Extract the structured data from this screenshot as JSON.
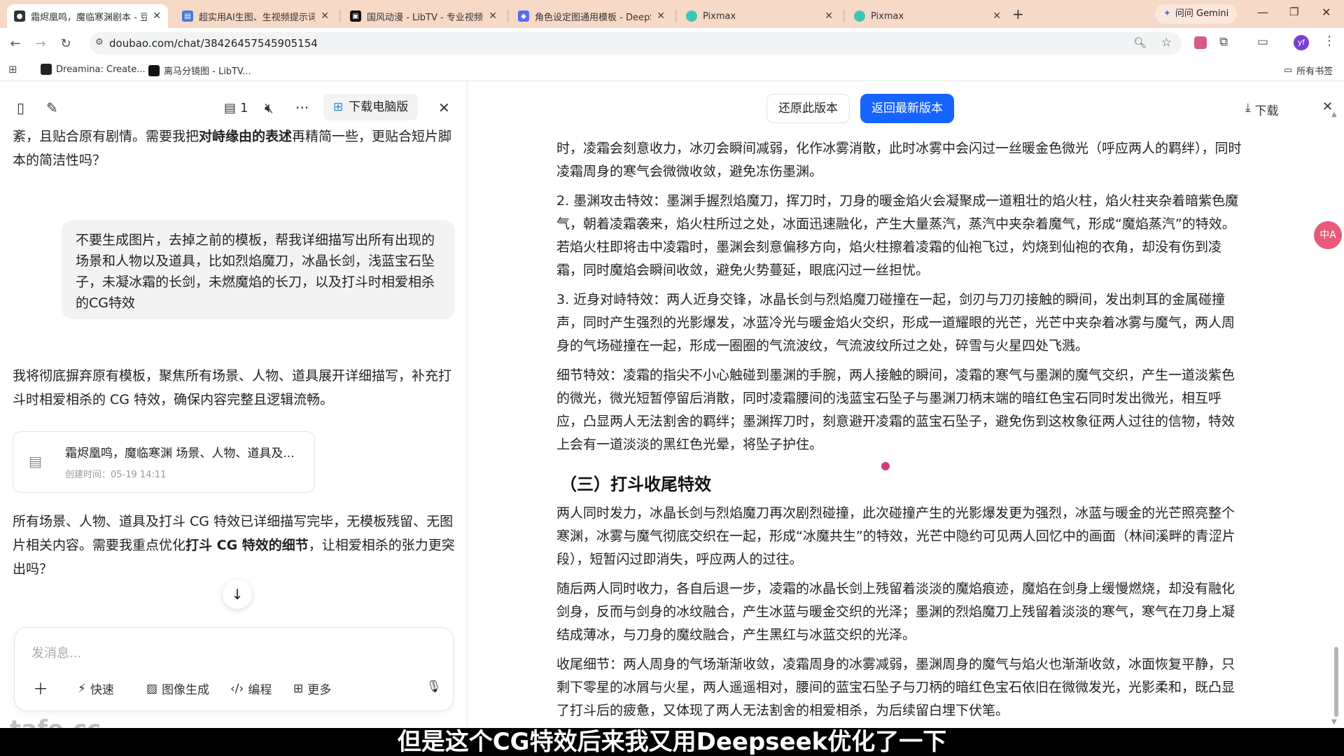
{
  "tabs": [
    {
      "title": "霜烬凰鸣，魔临寒渊剧本 - 豆包"
    },
    {
      "title": "超实用AI生图、生视频提示词模"
    },
    {
      "title": "国风动漫 - LibTV - 专业视频创"
    },
    {
      "title": "角色设定图通用模板 - DeepSe"
    },
    {
      "title": "Pixmax"
    },
    {
      "title": "Pixmax"
    }
  ],
  "gemini_label": "问问 Gemini",
  "url": "doubao.com/chat/38426457545905154",
  "bookmarks": [
    {
      "label": "Dreamina: Create..."
    },
    {
      "label": "离马分镜图 - LibTV..."
    }
  ],
  "all_bookmarks": "所有书签",
  "left": {
    "count": "1",
    "download_pc": "下载电脑版",
    "top_text_a": "紊，且贴合原有剧情。需要我把",
    "top_text_bold": "对峙缘由的表述",
    "top_text_b": "再精简一些，更贴合短片脚本的简洁性吗？",
    "user_msg": "不要生成图片，去掉之前的模板，帮我详细描写出所有出现的场景和人物以及道具，比如烈焰魔刀，冰晶长剑，浅蓝宝石坠子，未凝冰霜的长剑，未燃魔焰的长刀，以及打斗时相爱相杀的CG特效",
    "reply": "我将彻底摒弃原有模板，聚焦所有场景、人物、道具展开详细描写，补充打斗时相爱相杀的 CG 特效，确保内容完整且逻辑流畅。",
    "file_title": "霜烬凰鸣，魔临寒渊 场景、人物、道具及...",
    "file_time": "创建时间：05-19 14:11",
    "final_a": "所有场景、人物、道具及打斗 CG 特效已详细描写完毕，无模板残留、无图片相关内容。需要我重点优化",
    "final_bold": "打斗 CG 特效的细节",
    "final_b": "，让相爱相杀的张力更突出吗？",
    "input_placeholder": "发消息...",
    "buttons": [
      "快速",
      "图像生成",
      "编程",
      "更多"
    ]
  },
  "right": {
    "restore": "还原此版本",
    "latest": "返回最新版本",
    "download": "下载",
    "paragraphs": [
      "时，凌霜会刻意收力，冰刃会瞬间减弱，化作冰雾消散，此时冰雾中会闪过一丝暖金色微光（呼应两人的羁绊），同时凌霜周身的寒气会微微收敛，避免冻伤墨渊。",
      "2. 墨渊攻击特效：墨渊手握烈焰魔刀，挥刀时，刀身的暖金焰火会凝聚成一道粗壮的焰火柱，焰火柱夹杂着暗紫色魔气，朝着凌霜袭来，焰火柱所过之处，冰面迅速融化，产生大量蒸汽，蒸汽中夹杂着魔气，形成“魔焰蒸汽”的特效。若焰火柱即将击中凌霜时，墨渊会刻意偏移方向，焰火柱擦着凌霜的仙袍飞过，灼烧到仙袍的衣角，却没有伤到凌霜，同时魔焰会瞬间收敛，避免火势蔓延，眼底闪过一丝担忧。",
      "3. 近身对峙特效：两人近身交锋，冰晶长剑与烈焰魔刀碰撞在一起，剑刃与刀刃接触的瞬间，发出刺耳的金属碰撞声，同时产生强烈的光影爆发，冰蓝冷光与暖金焰火交织，形成一道耀眼的光芒，光芒中夹杂着冰雾与魔气，两人周身的气场碰撞在一起，形成一圈圈的气流波纹，气流波纹所过之处，碎雪与火星四处飞溅。",
      "细节特效：凌霜的指尖不小心触碰到墨渊的手腕，两人接触的瞬间，凌霜的寒气与墨渊的魔气交织，产生一道淡紫色的微光，微光短暂停留后消散，同时凌霜腰间的浅蓝宝石坠子与墨渊刀柄末端的暗红色宝石同时发出微光，相互呼应，凸显两人无法割舍的羁绊；墨渊挥刀时，刻意避开凌霜的蓝宝石坠子，避免伤到这枚象征两人过往的信物，特效上会有一道淡淡的黑红色光晕，将坠子护住。"
    ],
    "heading": "（三）打斗收尾特效",
    "paragraphs2": [
      "两人同时发力，冰晶长剑与烈焰魔刀再次剧烈碰撞，此次碰撞产生的光影爆发更为强烈，冰蓝与暖金的光芒照亮整个寒渊，冰雾与魔气彻底交织在一起，形成“冰魔共生”的特效，光芒中隐约可见两人回忆中的画面（林间溪畔的青涩片段），短暂闪过即消失，呼应两人的过往。",
      "随后两人同时收力，各自后退一步，凌霜的冰晶长剑上残留着淡淡的魔焰痕迹，魔焰在剑身上缓慢燃烧，却没有融化剑身，反而与剑身的冰纹融合，产生冰蓝与暖金交织的光泽；墨渊的烈焰魔刀上残留着淡淡的寒气，寒气在刀身上凝结成薄冰，与刀身的魔纹融合，产生黑红与冰蓝交织的光泽。",
      "收尾细节：两人周身的气场渐渐收敛，凌霜周身的冰雾减弱，墨渊周身的魔气与焰火也渐渐收敛，冰面恢复平静，只剩下零星的冰屑与火星，两人遥遥相对，腰间的蓝宝石坠子与刀柄的暗红色宝石依旧在微微发光，光影柔和，既凸显了打斗后的疲惫，又体现了两人无法割舍的相爱相杀，为后续留白埋下伏笔。"
    ]
  },
  "watermark": "tafe.cc",
  "subtitle": "但是这个CG特效后来我又用Deepseek优化了一下"
}
